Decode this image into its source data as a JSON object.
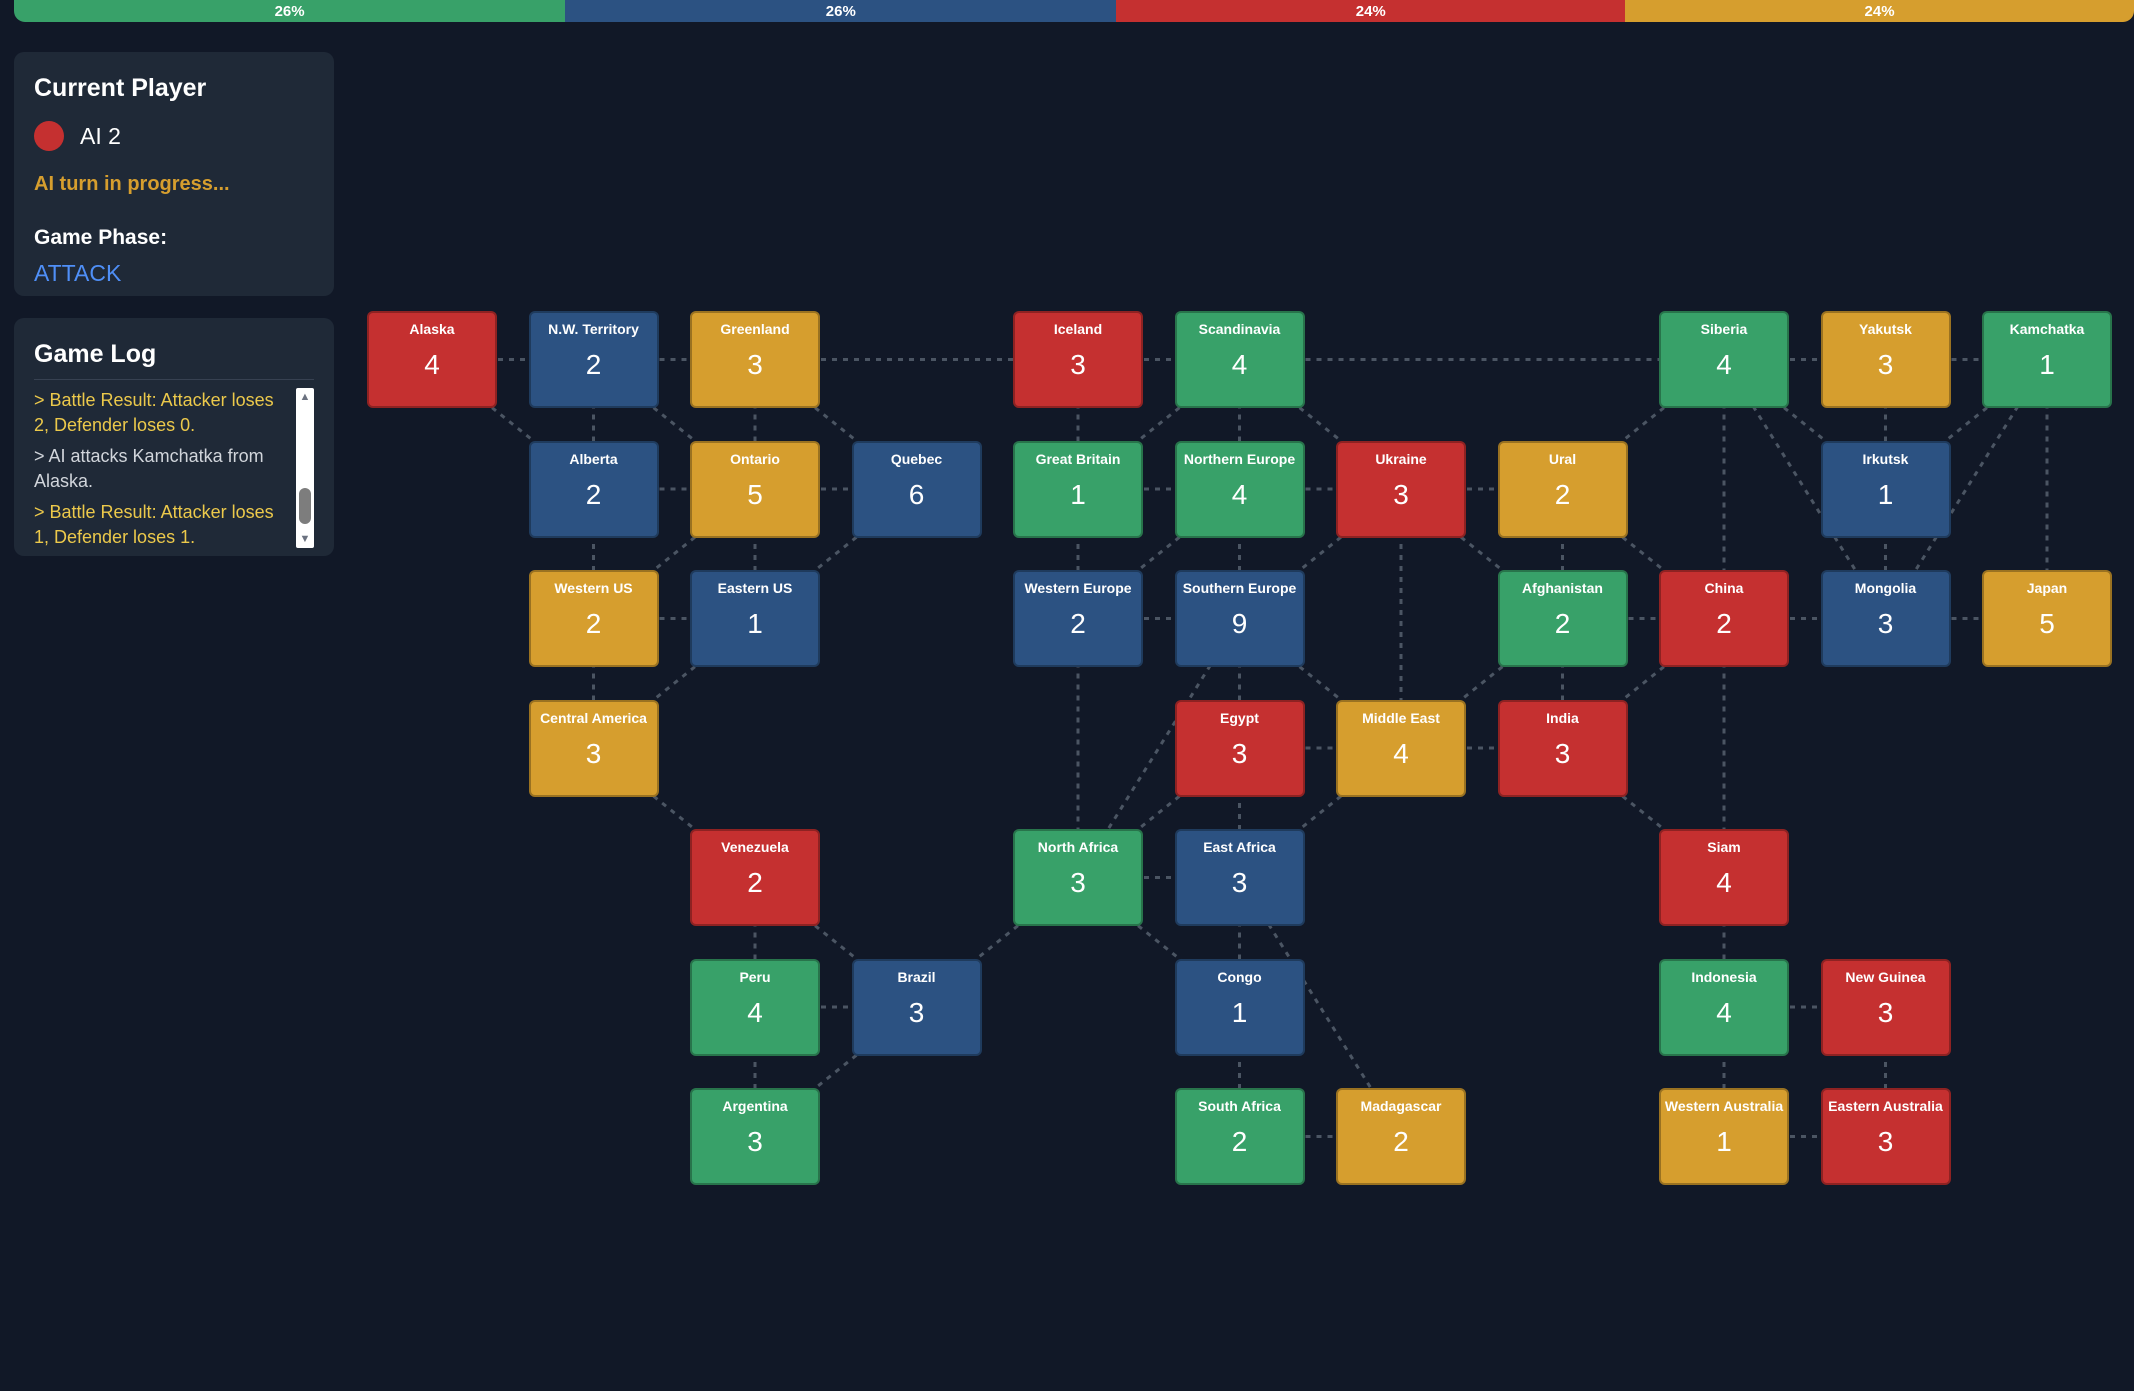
{
  "colors": {
    "green": "#38a169",
    "blue": "#2c5282",
    "red": "#c53030",
    "yellow": "#d69e2e",
    "status_yellow": "#d69e2e",
    "phase_blue": "#4f8ff7",
    "log_highlight": "#ecc94b",
    "log_normal": "#d1d5db"
  },
  "progress": [
    {
      "color": "green",
      "fraction": 0.26,
      "label": "26%"
    },
    {
      "color": "blue",
      "fraction": 0.26,
      "label": "26%"
    },
    {
      "color": "red",
      "fraction": 0.24,
      "label": "24%"
    },
    {
      "color": "yellow",
      "fraction": 0.24,
      "label": "24%"
    }
  ],
  "player_panel": {
    "title": "Current Player",
    "player_color": "red",
    "player_name": "AI 2",
    "status": "AI turn in progress...",
    "phase_label": "Game Phase:",
    "phase_value": "ATTACK"
  },
  "log": {
    "title": "Game Log",
    "entries": [
      {
        "text": "> Battle Result: Attacker loses 2, Defender loses 0.",
        "highlight": true
      },
      {
        "text": "> AI attacks Kamchatka from Alaska.",
        "highlight": false
      },
      {
        "text": "> Battle Result: Attacker loses 1, Defender loses 1.",
        "highlight": true
      }
    ]
  },
  "territories": [
    {
      "id": "alaska",
      "name": "Alaska",
      "armies": 4,
      "owner": "red",
      "col": 0,
      "row": 0
    },
    {
      "id": "nw-territory",
      "name": "N.W. Territory",
      "armies": 2,
      "owner": "blue",
      "col": 1,
      "row": 0
    },
    {
      "id": "greenland",
      "name": "Greenland",
      "armies": 3,
      "owner": "yellow",
      "col": 2,
      "row": 0
    },
    {
      "id": "iceland",
      "name": "Iceland",
      "armies": 3,
      "owner": "red",
      "col": 4,
      "row": 0
    },
    {
      "id": "scandinavia",
      "name": "Scandinavia",
      "armies": 4,
      "owner": "green",
      "col": 5,
      "row": 0
    },
    {
      "id": "siberia",
      "name": "Siberia",
      "armies": 4,
      "owner": "green",
      "col": 8,
      "row": 0
    },
    {
      "id": "yakutsk",
      "name": "Yakutsk",
      "armies": 3,
      "owner": "yellow",
      "col": 9,
      "row": 0
    },
    {
      "id": "kamchatka",
      "name": "Kamchatka",
      "armies": 1,
      "owner": "green",
      "col": 10,
      "row": 0
    },
    {
      "id": "alberta",
      "name": "Alberta",
      "armies": 2,
      "owner": "blue",
      "col": 1,
      "row": 1
    },
    {
      "id": "ontario",
      "name": "Ontario",
      "armies": 5,
      "owner": "yellow",
      "col": 2,
      "row": 1
    },
    {
      "id": "quebec",
      "name": "Quebec",
      "armies": 6,
      "owner": "blue",
      "col": 3,
      "row": 1
    },
    {
      "id": "great-britain",
      "name": "Great Britain",
      "armies": 1,
      "owner": "green",
      "col": 4,
      "row": 1
    },
    {
      "id": "northern-europe",
      "name": "Northern Europe",
      "armies": 4,
      "owner": "green",
      "col": 5,
      "row": 1
    },
    {
      "id": "ukraine",
      "name": "Ukraine",
      "armies": 3,
      "owner": "red",
      "col": 6,
      "row": 1
    },
    {
      "id": "ural",
      "name": "Ural",
      "armies": 2,
      "owner": "yellow",
      "col": 7,
      "row": 1
    },
    {
      "id": "irkutsk",
      "name": "Irkutsk",
      "armies": 1,
      "owner": "blue",
      "col": 9,
      "row": 1
    },
    {
      "id": "western-us",
      "name": "Western US",
      "armies": 2,
      "owner": "yellow",
      "col": 1,
      "row": 2
    },
    {
      "id": "eastern-us",
      "name": "Eastern US",
      "armies": 1,
      "owner": "blue",
      "col": 2,
      "row": 2
    },
    {
      "id": "western-europe",
      "name": "Western Europe",
      "armies": 2,
      "owner": "blue",
      "col": 4,
      "row": 2
    },
    {
      "id": "southern-europe",
      "name": "Southern Europe",
      "armies": 9,
      "owner": "blue",
      "col": 5,
      "row": 2
    },
    {
      "id": "afghanistan",
      "name": "Afghanistan",
      "armies": 2,
      "owner": "green",
      "col": 7,
      "row": 2
    },
    {
      "id": "china",
      "name": "China",
      "armies": 2,
      "owner": "red",
      "col": 8,
      "row": 2
    },
    {
      "id": "mongolia",
      "name": "Mongolia",
      "armies": 3,
      "owner": "blue",
      "col": 9,
      "row": 2
    },
    {
      "id": "japan",
      "name": "Japan",
      "armies": 5,
      "owner": "yellow",
      "col": 10,
      "row": 2
    },
    {
      "id": "central-america",
      "name": "Central America",
      "armies": 3,
      "owner": "yellow",
      "col": 1,
      "row": 3
    },
    {
      "id": "egypt",
      "name": "Egypt",
      "armies": 3,
      "owner": "red",
      "col": 5,
      "row": 3
    },
    {
      "id": "middle-east",
      "name": "Middle East",
      "armies": 4,
      "owner": "yellow",
      "col": 6,
      "row": 3
    },
    {
      "id": "india",
      "name": "India",
      "armies": 3,
      "owner": "red",
      "col": 7,
      "row": 3
    },
    {
      "id": "venezuela",
      "name": "Venezuela",
      "armies": 2,
      "owner": "red",
      "col": 2,
      "row": 4
    },
    {
      "id": "north-africa",
      "name": "North Africa",
      "armies": 3,
      "owner": "green",
      "col": 4,
      "row": 4
    },
    {
      "id": "east-africa",
      "name": "East Africa",
      "armies": 3,
      "owner": "blue",
      "col": 5,
      "row": 4
    },
    {
      "id": "siam",
      "name": "Siam",
      "armies": 4,
      "owner": "red",
      "col": 8,
      "row": 4
    },
    {
      "id": "peru",
      "name": "Peru",
      "armies": 4,
      "owner": "green",
      "col": 2,
      "row": 5
    },
    {
      "id": "brazil",
      "name": "Brazil",
      "armies": 3,
      "owner": "blue",
      "col": 3,
      "row": 5
    },
    {
      "id": "congo",
      "name": "Congo",
      "armies": 1,
      "owner": "blue",
      "col": 5,
      "row": 5
    },
    {
      "id": "indonesia",
      "name": "Indonesia",
      "armies": 4,
      "owner": "green",
      "col": 8,
      "row": 5
    },
    {
      "id": "new-guinea",
      "name": "New Guinea",
      "armies": 3,
      "owner": "red",
      "col": 9,
      "row": 5
    },
    {
      "id": "argentina",
      "name": "Argentina",
      "armies": 3,
      "owner": "green",
      "col": 2,
      "row": 6
    },
    {
      "id": "south-africa",
      "name": "South Africa",
      "armies": 2,
      "owner": "green",
      "col": 5,
      "row": 6
    },
    {
      "id": "madagascar",
      "name": "Madagascar",
      "armies": 2,
      "owner": "yellow",
      "col": 6,
      "row": 6
    },
    {
      "id": "western-australia",
      "name": "Western Australia",
      "armies": 1,
      "owner": "yellow",
      "col": 8,
      "row": 6
    },
    {
      "id": "eastern-australia",
      "name": "Eastern Australia",
      "armies": 3,
      "owner": "red",
      "col": 9,
      "row": 6
    }
  ],
  "connections": [
    [
      "alaska",
      "nw-territory"
    ],
    [
      "alaska",
      "alberta"
    ],
    [
      "nw-territory",
      "greenland"
    ],
    [
      "nw-territory",
      "alberta"
    ],
    [
      "nw-territory",
      "ontario"
    ],
    [
      "greenland",
      "ontario"
    ],
    [
      "greenland",
      "quebec"
    ],
    [
      "greenland",
      "iceland"
    ],
    [
      "iceland",
      "scandinavia"
    ],
    [
      "iceland",
      "great-britain"
    ],
    [
      "scandinavia",
      "siberia"
    ],
    [
      "scandinavia",
      "northern-europe"
    ],
    [
      "scandinavia",
      "great-britain"
    ],
    [
      "scandinavia",
      "ukraine"
    ],
    [
      "siberia",
      "yakutsk"
    ],
    [
      "siberia",
      "ural"
    ],
    [
      "siberia",
      "irkutsk"
    ],
    [
      "siberia",
      "mongolia"
    ],
    [
      "siberia",
      "china"
    ],
    [
      "yakutsk",
      "kamchatka"
    ],
    [
      "yakutsk",
      "irkutsk"
    ],
    [
      "kamchatka",
      "irkutsk"
    ],
    [
      "kamchatka",
      "mongolia"
    ],
    [
      "kamchatka",
      "japan"
    ],
    [
      "alberta",
      "ontario"
    ],
    [
      "alberta",
      "western-us"
    ],
    [
      "ontario",
      "quebec"
    ],
    [
      "ontario",
      "western-us"
    ],
    [
      "ontario",
      "eastern-us"
    ],
    [
      "quebec",
      "eastern-us"
    ],
    [
      "great-britain",
      "northern-europe"
    ],
    [
      "great-britain",
      "western-europe"
    ],
    [
      "northern-europe",
      "ukraine"
    ],
    [
      "northern-europe",
      "western-europe"
    ],
    [
      "northern-europe",
      "southern-europe"
    ],
    [
      "ukraine",
      "ural"
    ],
    [
      "ukraine",
      "afghanistan"
    ],
    [
      "ukraine",
      "southern-europe"
    ],
    [
      "ukraine",
      "middle-east"
    ],
    [
      "ural",
      "afghanistan"
    ],
    [
      "ural",
      "china"
    ],
    [
      "irkutsk",
      "mongolia"
    ],
    [
      "western-us",
      "eastern-us"
    ],
    [
      "western-us",
      "central-america"
    ],
    [
      "eastern-us",
      "central-america"
    ],
    [
      "western-europe",
      "southern-europe"
    ],
    [
      "western-europe",
      "north-africa"
    ],
    [
      "southern-europe",
      "egypt"
    ],
    [
      "southern-europe",
      "middle-east"
    ],
    [
      "southern-europe",
      "north-africa"
    ],
    [
      "afghanistan",
      "china"
    ],
    [
      "afghanistan",
      "india"
    ],
    [
      "afghanistan",
      "middle-east"
    ],
    [
      "china",
      "mongolia"
    ],
    [
      "china",
      "india"
    ],
    [
      "china",
      "siam"
    ],
    [
      "mongolia",
      "japan"
    ],
    [
      "central-america",
      "venezuela"
    ],
    [
      "egypt",
      "middle-east"
    ],
    [
      "egypt",
      "north-africa"
    ],
    [
      "egypt",
      "east-africa"
    ],
    [
      "middle-east",
      "india"
    ],
    [
      "middle-east",
      "east-africa"
    ],
    [
      "india",
      "siam"
    ],
    [
      "venezuela",
      "peru"
    ],
    [
      "venezuela",
      "brazil"
    ],
    [
      "north-africa",
      "east-africa"
    ],
    [
      "north-africa",
      "brazil"
    ],
    [
      "north-africa",
      "congo"
    ],
    [
      "east-africa",
      "congo"
    ],
    [
      "east-africa",
      "madagascar"
    ],
    [
      "siam",
      "indonesia"
    ],
    [
      "peru",
      "brazil"
    ],
    [
      "peru",
      "argentina"
    ],
    [
      "brazil",
      "argentina"
    ],
    [
      "congo",
      "south-africa"
    ],
    [
      "indonesia",
      "new-guinea"
    ],
    [
      "indonesia",
      "western-australia"
    ],
    [
      "new-guinea",
      "eastern-australia"
    ],
    [
      "south-africa",
      "madagascar"
    ],
    [
      "western-australia",
      "eastern-australia"
    ]
  ]
}
